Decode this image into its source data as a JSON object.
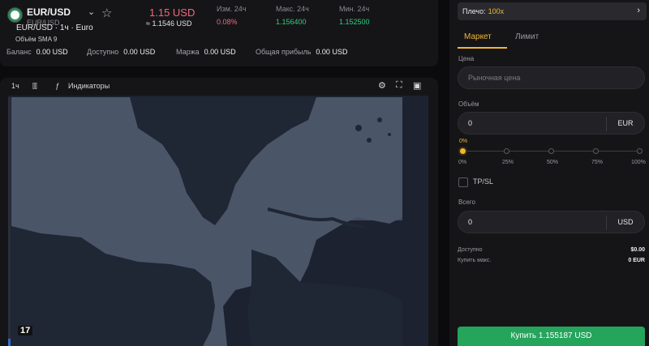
{
  "ticker": {
    "pair": "EUR/USD",
    "pair_sub": "EUR/USD",
    "price": "1.15 USD",
    "price_sub": "≈ 1.1546 USD",
    "stats": [
      {
        "label": "Изм. 24ч",
        "value": "0.08%",
        "color": "#f0687a"
      },
      {
        "label": "Макс. 24ч",
        "value": "1.156400",
        "color": "#2fd17e"
      },
      {
        "label": "Мин. 24ч",
        "value": "1.152500",
        "color": "#2fd17e"
      }
    ],
    "balance": {
      "label": "Баланс",
      "value": "0.00 USD"
    },
    "available": {
      "label": "Доступно",
      "value": "0.00 USD"
    },
    "margin": {
      "label": "Маржа",
      "value": "0.00 USD"
    },
    "profit": {
      "label": "Общая прибыль",
      "value": "0.00 USD"
    }
  },
  "chart": {
    "interval": "1ч",
    "indicators_label": "Индикаторы",
    "legend_symbol": "EUR/USD · 1ч · Euro",
    "legend_volume": "Объём SMA 9",
    "tv_logo": "17"
  },
  "order": {
    "leverage_label": "Плечо:",
    "leverage_value": "100x",
    "tabs": [
      {
        "label": "Маркет",
        "active": true
      },
      {
        "label": "Лимит",
        "active": false
      }
    ],
    "price_label": "Цена",
    "price_placeholder": "Рыночная цена",
    "volume_label": "Объём",
    "volume_value": "0",
    "volume_unit": "EUR",
    "slider_value": "0%",
    "slider_marks": [
      "0%",
      "25%",
      "50%",
      "75%",
      "100%"
    ],
    "tpsl_label": "TP/SL",
    "total_label": "Всего",
    "total_value": "0",
    "total_unit": "USD",
    "available_label": "Доступно",
    "available_value": "$0.00",
    "max_buy_label": "Купить макс.",
    "max_buy_value": "0 EUR",
    "buy_button": "Купить  1.155187 USD"
  },
  "colors": {
    "accent": "#f2b632",
    "buy": "#25a45c",
    "down": "#f0687a",
    "up": "#2fd17e"
  }
}
